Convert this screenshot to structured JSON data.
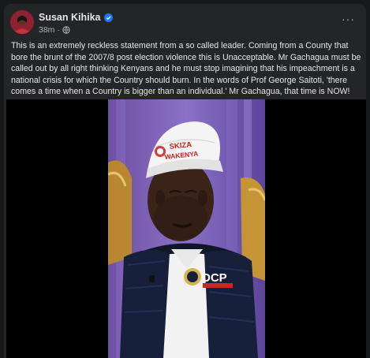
{
  "post": {
    "author": "Susan Kihika",
    "time": "38m",
    "separator": "·",
    "more_label": "···",
    "text": "This is an extremely reckless statement from a so called leader. Coming from a County that bore the brunt of the 2007/8 post election violence this is Unacceptable. Mr Gachagua must be called out by all right thinking Kenyans and he must stop imagining that his impeachment is a national crisis for which the Country should burn. In the words of Prof George Saitoti, 'there comes a time when a Country is bigger than an individual.' Mr Gachagua, that time is NOW!"
  },
  "video": {
    "cap_text_line1": "SKIZA",
    "cap_text_line2": "WAKENYA",
    "vest_logo_text": "DCP"
  },
  "icons": {
    "verified": "verified-badge-icon",
    "privacy": "globe-icon",
    "more": "more-options-icon"
  },
  "colors": {
    "background": "#18191a",
    "card": "#242526",
    "primary_text": "#e4e6eb",
    "secondary_text": "#b0b3b8",
    "verified_blue": "#1877f2"
  }
}
